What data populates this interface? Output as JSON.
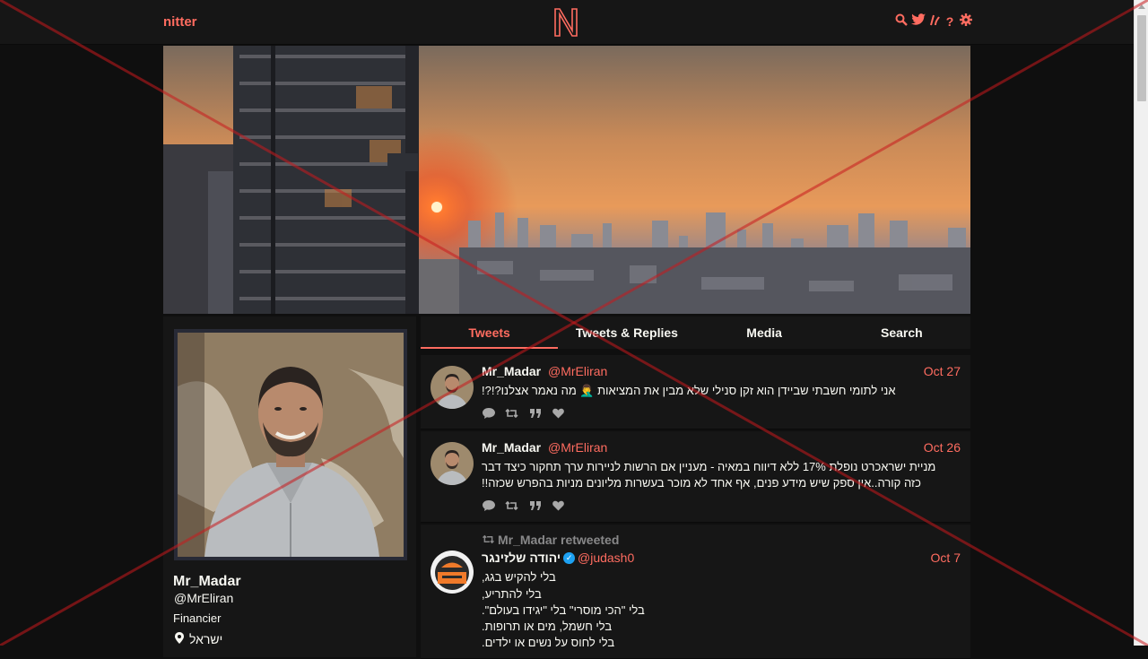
{
  "navbar": {
    "brand": "nitter",
    "logo_letter": "N",
    "icons": [
      "search-icon",
      "twitter-icon",
      "rss-icon",
      "help-icon",
      "settings-icon"
    ]
  },
  "profile": {
    "display_name": "Mr_Madar",
    "handle": "@MrEliran",
    "bio": "Financier",
    "location": "ישראל"
  },
  "tabs": [
    {
      "label": "Tweets",
      "active": true
    },
    {
      "label": "Tweets & Replies",
      "active": false
    },
    {
      "label": "Media",
      "active": false
    },
    {
      "label": "Search",
      "active": false
    }
  ],
  "tweets": [
    {
      "name": "Mr_Madar",
      "handle": "@MrEliran",
      "date": "Oct 27",
      "body": "אני לתומי חשבתי שביידן הוא זקן סנילי שלא מבין את המציאות 🤦‍♂️ מה נאמר אצלנו?!?!"
    },
    {
      "name": "Mr_Madar",
      "handle": "@MrEliran",
      "date": "Oct 26",
      "body_line1": "מניית ישראכרט נופלת 17% ללא דיווח במאיה - מעניין אם הרשות לניירות ערך תחקור כיצד דבר",
      "body_line2": "כזה קורה..אין ספק שיש מידע פנים, אף אחד לא מוכר בעשרות מליונים מניות בהפרש שכזה!!"
    },
    {
      "retweet_header": "Mr_Madar retweeted",
      "name": "יהודה שלזינגר",
      "handle": "@judash0",
      "date": "Oct 7",
      "lines": [
        "בלי להקיש בגג,",
        "בלי להתריע,",
        "בלי \"הכי מוסרי\" בלי \"יגידו בעולם\".",
        "בלי חשמל, מים או תרופות.",
        "בלי לחוס על נשים או ילדים."
      ]
    }
  ],
  "colors": {
    "accent": "#ff6c60",
    "background": "#0f0f0f",
    "panel": "#161616",
    "text": "#f8f8f2"
  }
}
